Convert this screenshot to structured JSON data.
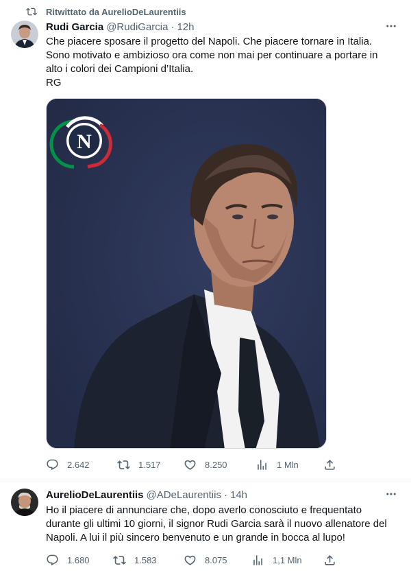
{
  "tweet1": {
    "retweet_label": "Ritwittato da AurelioDeLaurentiis",
    "author_name": "Rudi Garcia",
    "author_handle": "@RudiGarcia",
    "separator": "·",
    "time": "12h",
    "text_lines": [
      "Che piacere sposare il progetto del Napoli. Che piacere tornare in Italia.",
      "Sono motivato e ambizioso ora come non mai per continuare a portare in",
      "alto i colori dei Campioni d’Italia.",
      "RG"
    ],
    "media": {
      "logo_letter": "N",
      "logo_colors": [
        "#009246",
        "#ffffff",
        "#ce2b37"
      ],
      "background": "#27304f"
    },
    "stats": {
      "replies": "2.642",
      "retweets": "1.517",
      "likes": "8.250",
      "views": "1 Mln"
    }
  },
  "tweet2": {
    "author_name": "AurelioDeLaurentiis",
    "author_handle": "@ADeLaurentiis",
    "separator": "·",
    "time": "14h",
    "text_lines": [
      "Ho il piacere di annunciare che, dopo averlo conosciuto e frequentato",
      "durante gli ultimi 10 giorni, il signor Rudi Garcia sarà il nuovo allenatore del",
      "Napoli. A lui il più sincero benvenuto e un grande in bocca al lupo!"
    ],
    "stats": {
      "replies": "1.680",
      "retweets": "1.583",
      "likes": "8.075",
      "views": "1,1 Mln"
    }
  },
  "icons": [
    "retweet-icon",
    "more-icon",
    "reply-icon",
    "retweet-icon",
    "like-icon",
    "views-icon",
    "share-icon"
  ],
  "colors": {
    "text": "#0f1419",
    "secondary": "#536471",
    "border": "#eff3f4"
  }
}
